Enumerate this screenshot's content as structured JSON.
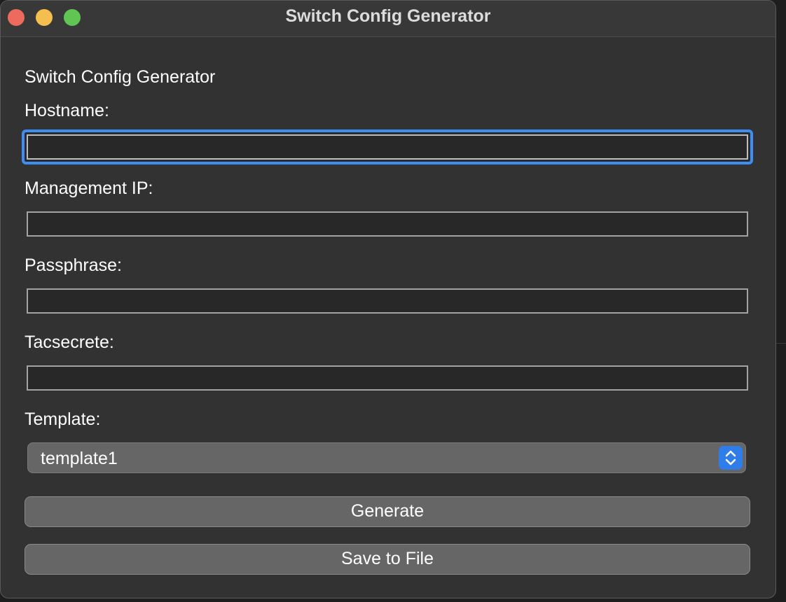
{
  "window": {
    "title": "Switch Config Generator"
  },
  "form": {
    "heading": "Switch Config Generator",
    "hostname_label": "Hostname:",
    "hostname_value": "",
    "management_ip_label": "Management IP:",
    "management_ip_value": "",
    "passphrase_label": "Passphrase:",
    "passphrase_value": "",
    "tacsecrete_label": "Tacsecrete:",
    "tacsecrete_value": "",
    "template_label": "Template:",
    "template_value": "template1"
  },
  "buttons": {
    "generate_label": "Generate",
    "save_label": "Save to File"
  },
  "colors": {
    "accent": "#3d8ef2",
    "window_bg": "#323232",
    "button_bg": "#666666"
  }
}
